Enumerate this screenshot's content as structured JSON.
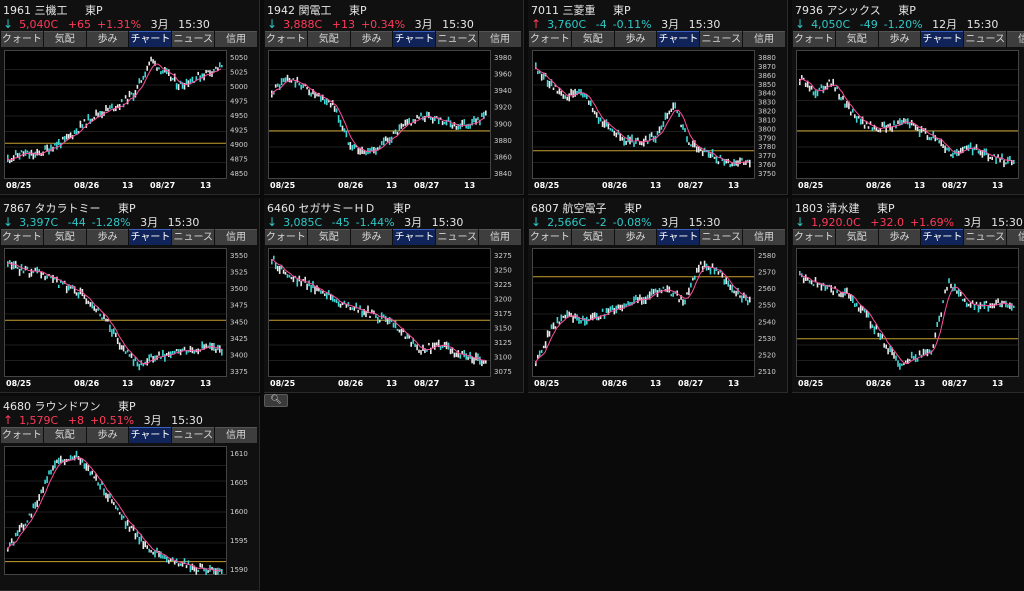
{
  "tabs": [
    "クォート",
    "気配",
    "歩み",
    "チャート",
    "ニュース",
    "信用"
  ],
  "active_tab_index": 3,
  "colors": {
    "up": "#ff3a5a",
    "down": "#30c7c7",
    "baseline": "#c8a030",
    "ma": "#ff4fa0"
  },
  "panels": [
    {
      "code": "1961",
      "name": "三機工",
      "market": "東P",
      "dir": "down",
      "price": "5,040C",
      "change": "+65",
      "pct": "+1.31%",
      "month": "3月",
      "time": "15:30",
      "y_ticks": [
        "5050",
        "5025",
        "5000",
        "4975",
        "4950",
        "4925",
        "4900",
        "4875",
        "4850"
      ],
      "x_ticks": [
        "08/25",
        "08/26",
        "13",
        "08/27",
        "13"
      ]
    },
    {
      "code": "1942",
      "name": "関電工",
      "market": "東P",
      "dir": "down",
      "price": "3,888C",
      "change": "+13",
      "pct": "+0.34%",
      "month": "3月",
      "time": "15:30",
      "y_ticks": [
        "3980",
        "3960",
        "3940",
        "3920",
        "3900",
        "3880",
        "3860",
        "3840"
      ],
      "x_ticks": [
        "08/25",
        "08/26",
        "13",
        "08/27",
        "13"
      ]
    },
    {
      "code": "7011",
      "name": "三菱重",
      "market": "東P",
      "dir": "up",
      "price": "3,760C",
      "change": "-4",
      "pct": "-0.11%",
      "month": "3月",
      "time": "15:30",
      "y_ticks": [
        "3880",
        "3870",
        "3860",
        "3850",
        "3840",
        "3830",
        "3820",
        "3810",
        "3800",
        "3790",
        "3780",
        "3770",
        "3760",
        "3750"
      ],
      "x_ticks": [
        "08/25",
        "08/26",
        "13",
        "08/27",
        "13"
      ]
    },
    {
      "code": "7936",
      "name": "アシックス",
      "market": "東P",
      "dir": "down",
      "price": "4,050C",
      "change": "-49",
      "pct": "-1.20%",
      "month": "12月",
      "time": "15:30",
      "y_ticks": [],
      "x_ticks": [
        "08/25",
        "08/26",
        "13",
        "08/27",
        "13"
      ]
    },
    {
      "code": "7867",
      "name": "タカラトミー",
      "market": "東P",
      "dir": "down",
      "price": "3,397C",
      "change": "-44",
      "pct": "-1.28%",
      "month": "3月",
      "time": "15:30",
      "y_ticks": [
        "3550",
        "3525",
        "3500",
        "3475",
        "3450",
        "3425",
        "3400",
        "3375"
      ],
      "x_ticks": [
        "08/25",
        "08/26",
        "13",
        "08/27",
        "13"
      ]
    },
    {
      "code": "6460",
      "name": "セガサミーＨＤ",
      "market": "東P",
      "dir": "down",
      "price": "3,085C",
      "change": "-45",
      "pct": "-1.44%",
      "month": "3月",
      "time": "15:30",
      "y_ticks": [
        "3275",
        "3250",
        "3225",
        "3200",
        "3175",
        "3150",
        "3125",
        "3100",
        "3075"
      ],
      "x_ticks": [
        "08/25",
        "08/26",
        "13",
        "08/27",
        "13"
      ]
    },
    {
      "code": "6807",
      "name": "航空電子",
      "market": "東P",
      "dir": "down",
      "price": "2,566C",
      "change": "-2",
      "pct": "-0.08%",
      "month": "3月",
      "time": "15:30",
      "y_ticks": [
        "2580",
        "2570",
        "2560",
        "2550",
        "2540",
        "2530",
        "2520",
        "2510"
      ],
      "x_ticks": [
        "08/25",
        "08/26",
        "13",
        "08/27",
        "13"
      ]
    },
    {
      "code": "1803",
      "name": "清水建",
      "market": "東P",
      "dir": "down",
      "price": "1,920.0C",
      "change": "+32.0",
      "pct": "+1.69%",
      "month": "3月",
      "time": "15:30",
      "y_ticks": [],
      "x_ticks": [
        "08/25",
        "08/26",
        "13",
        "08/27",
        "13"
      ]
    },
    {
      "code": "4680",
      "name": "ラウンドワン",
      "market": "東P",
      "dir": "up",
      "price": "1,579C",
      "change": "+8",
      "pct": "+0.51%",
      "month": "3月",
      "time": "15:30",
      "y_ticks": [
        "1610",
        "1605",
        "1600",
        "1595",
        "1590"
      ],
      "x_ticks": []
    }
  ],
  "search_icon": "magnifier-icon"
}
